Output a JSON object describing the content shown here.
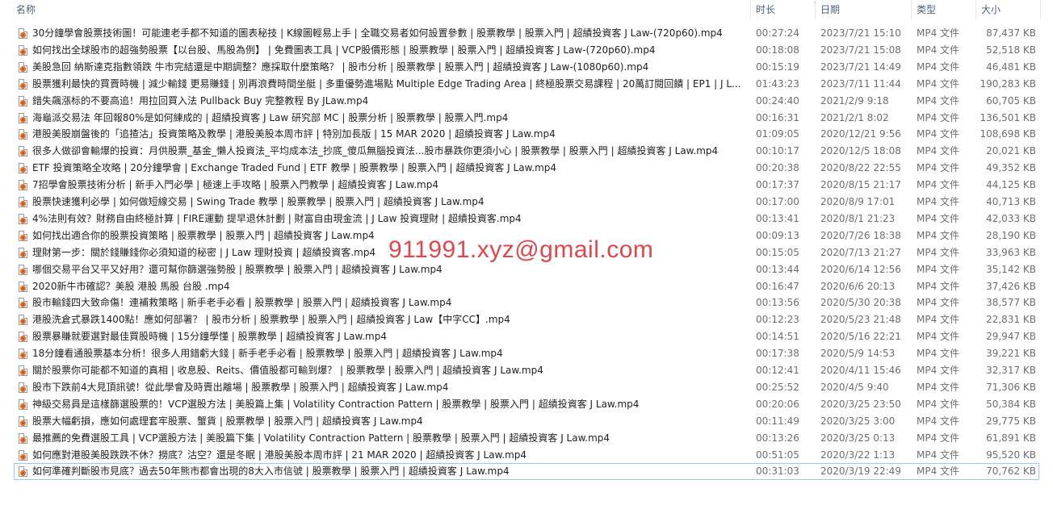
{
  "columns": {
    "name": "名称",
    "duration": "时长",
    "date": "日期",
    "type": "类型",
    "size": "大小"
  },
  "watermark": "911991.xyz@gmail.com",
  "files": [
    {
      "name": "30分鐘學會股票技術圖！可能連老手都不知道的圖表秘技 | K線圖輕易上手 | 全職交易者如何設置參數 | 股票教學 | 股票入門 | 超績投資客 J Law-(720p60).mp4",
      "duration": "00:27:24",
      "date": "2023/7/21 15:10",
      "type": "MP4 文件",
      "size": "87,437 KB"
    },
    {
      "name": "如何找出全球股市的超強勢股票【以台股、馬股為例】 | 免費圖表工具 | VCP股價形態 | 股票教學 | 股票入門 | 超績投資客 J Law-(720p60).mp4",
      "duration": "00:18:08",
      "date": "2023/7/21 15:08",
      "type": "MP4 文件",
      "size": "52,518 KB"
    },
    {
      "name": "美股急回 納斯達克指數領跌 牛市完結還是中期調整？應採取什麼策略？ | 股市分析 | 股票教學 | 股票入門 | 超績投資客 J Law-(1080p60).mp4",
      "duration": "00:15:19",
      "date": "2023/7/21 14:49",
      "type": "MP4 文件",
      "size": "46,481 KB"
    },
    {
      "name": "股票獲利最快的買賣時機 | 減少輸錢 更易賺錢 | 別再浪費時間坐艇 | 多重優勢進場點 Multiple Edge Trading Area | 終極股票交易課程 | 20萬訂閱回饋 | EP1 | J L...",
      "duration": "01:43:23",
      "date": "2023/7/11 11:44",
      "type": "MP4 文件",
      "size": "190,283 KB"
    },
    {
      "name": "錯失飆漲标的不要高追！用拉回買入法 Pullback Buy 完整教程 By JLaw.mp4",
      "duration": "00:24:40",
      "date": "2021/2/9 9:18",
      "type": "MP4 文件",
      "size": "60,705 KB"
    },
    {
      "name": "海龜派交易法 年回報80%是如何練成的 | 超績投資客 J Law 研究部 MC | 股票分析 | 股票教學 | 股票入門.mp4",
      "duration": "00:16:31",
      "date": "2021/2/1 8:02",
      "type": "MP4 文件",
      "size": "136,501 KB"
    },
    {
      "name": "港股美股崩盤後的「追揸沽」投資策略及教學 | 港股美股本周市評 | 特別加長版 | 15 MAR 2020 | 超績投資客 J Law.mp4",
      "duration": "01:09:05",
      "date": "2020/12/21 9:56",
      "type": "MP4 文件",
      "size": "108,698 KB"
    },
    {
      "name": "很多人做卻會輸爆的投資：月供股票_基金_懶人投資法_平均成本法_抄底_傻瓜無腦投資法...股市暴跌你更須小心 | 股票教學 | 股票入門 | 超績投資客 J Law.mp4",
      "duration": "00:10:17",
      "date": "2020/12/5 18:08",
      "type": "MP4 文件",
      "size": "20,021 KB"
    },
    {
      "name": "ETF 投資策略全攻略 | 20分鐘學會 | Exchange Traded Fund | ETF 教學 | 股票教學 | 股票入門 | 超績投資客 J Law.mp4",
      "duration": "00:20:38",
      "date": "2020/8/22 22:55",
      "type": "MP4 文件",
      "size": "49,352 KB"
    },
    {
      "name": "7招學會股票技術分析 | 新手入門必學 | 極速上手攻略 | 股票入門教學 | 超績投資客 J Law.mp4",
      "duration": "00:17:37",
      "date": "2020/8/15 21:17",
      "type": "MP4 文件",
      "size": "44,125 KB"
    },
    {
      "name": "股票快速獲利必學 | 如何做短線交易 | Swing Trade 教學 | 股票教學 | 股票入門 | 超績投資客 J Law.mp4",
      "duration": "00:17:00",
      "date": "2020/8/9 17:01",
      "type": "MP4 文件",
      "size": "40,713 KB"
    },
    {
      "name": "4%法則有效？財務自由終極計算 | FIRE運動 提早退休計劃 | 財富自由現金流 | J Law 投資理財 | 超績投資客.mp4",
      "duration": "00:13:41",
      "date": "2020/8/1 21:23",
      "type": "MP4 文件",
      "size": "42,033 KB"
    },
    {
      "name": "如何找出適合你的股票投資策略 | 股票教學 | 股票入門 | 超績投資客 J Law.mp4",
      "duration": "00:09:13",
      "date": "2020/7/26 18:38",
      "type": "MP4 文件",
      "size": "28,190 KB"
    },
    {
      "name": "理財第一步：關於錢賺錢你必須知道的秘密 | J Law 理財投資 | 超績投資客.mp4",
      "duration": "00:15:05",
      "date": "2020/7/13 21:27",
      "type": "MP4 文件",
      "size": "33,963 KB"
    },
    {
      "name": "哪個交易平台又平又好用？還可幫你篩選強勢股 | 股票教學 | 股票入門 | 超績投資客 J Law.mp4",
      "duration": "00:13:44",
      "date": "2020/6/14 12:56",
      "type": "MP4 文件",
      "size": "35,142 KB"
    },
    {
      "name": "2020新牛市確認？美股 港股 馬股 台股 .mp4",
      "duration": "00:16:47",
      "date": "2020/6/6 20:13",
      "type": "MP4 文件",
      "size": "37,426 KB"
    },
    {
      "name": "股市輸錢四大致命傷！連補救策略 | 新手老手必看 | 股票教學 | 股票入門 | 超績投資客 J Law.mp4",
      "duration": "00:13:56",
      "date": "2020/5/30 20:38",
      "type": "MP4 文件",
      "size": "38,577 KB"
    },
    {
      "name": "港股洗倉式暴跌1400點！應如何部署？ | 股市分析 | 股票教學 | 股票入門 | 超績投資客 J Law【中字CC】.mp4",
      "duration": "00:12:23",
      "date": "2020/5/23 21:48",
      "type": "MP4 文件",
      "size": "22,831 KB"
    },
    {
      "name": "股票暴賺就要選對最佳買股時機 | 15分鐘學懂 | 股票教學 | 超績投資客 J Law.mp4",
      "duration": "00:14:51",
      "date": "2020/5/16 22:21",
      "type": "MP4 文件",
      "size": "29,947 KB"
    },
    {
      "name": "18分鐘看通股票基本分析！很多人用錯虧大錢 | 新手老手必看 | 股票教學 | 股票入門 | 超績投資客 J Law.mp4",
      "duration": "00:17:38",
      "date": "2020/5/9 14:53",
      "type": "MP4 文件",
      "size": "39,221 KB"
    },
    {
      "name": "關於股票你可能都不知道的真相 | 收息股、Reits、價值股都可輸到爆？ | 股票教學 | 股票入門 | 超績投資客 J Law.mp4",
      "duration": "00:12:41",
      "date": "2020/4/11 15:46",
      "type": "MP4 文件",
      "size": "32,317 KB"
    },
    {
      "name": "股市下跌前4大見頂訊號！從此學會及時賣出離場 | 股票教學 | 股票入門 | 超績投資客 J Law.mp4",
      "duration": "00:25:52",
      "date": "2020/4/5 9:40",
      "type": "MP4 文件",
      "size": "71,306 KB"
    },
    {
      "name": "神級交易員是這樣篩選股票的！VCP選股方法 | 美股篇上集 | Volatility Contraction Pattern | 股票教學 | 股票入門 | 超績投資客 J Law.mp4",
      "duration": "00:20:06",
      "date": "2020/3/25 23:50",
      "type": "MP4 文件",
      "size": "50,384 KB"
    },
    {
      "name": "股票大幅虧損，應如何處理套牢股票、蟹貨 | 股票教學 | 股票入門 | 超績投資客 J Law.mp4",
      "duration": "00:11:49",
      "date": "2020/3/25 3:00",
      "type": "MP4 文件",
      "size": "29,775 KB"
    },
    {
      "name": "最推薦的免費選股工具 | VCP選股方法 | 美股篇下集 | Volatility Contraction Pattern | 股票教學 | 股票入門 | 超績投資客 J Law.mp4",
      "duration": "00:13:26",
      "date": "2020/3/25 0:13",
      "type": "MP4 文件",
      "size": "61,891 KB"
    },
    {
      "name": "如何應對港股美股跌跌不休？撈底？沽空？還是冬眠 | 港股美股本周市評 | 21 MAR 2020 | 超績投資客 J Law.mp4",
      "duration": "00:51:05",
      "date": "2020/3/22 1:13",
      "type": "MP4 文件",
      "size": "95,520 KB"
    },
    {
      "name": "如何準確判斷股市見底？過去50年熊市都會出現的8大入市信號 | 股票教學 | 股票入門 | 超績投資客 J Law.mp4",
      "duration": "00:31:03",
      "date": "2020/3/19 22:49",
      "type": "MP4 文件",
      "size": "70,762 KB",
      "focused": true
    }
  ]
}
